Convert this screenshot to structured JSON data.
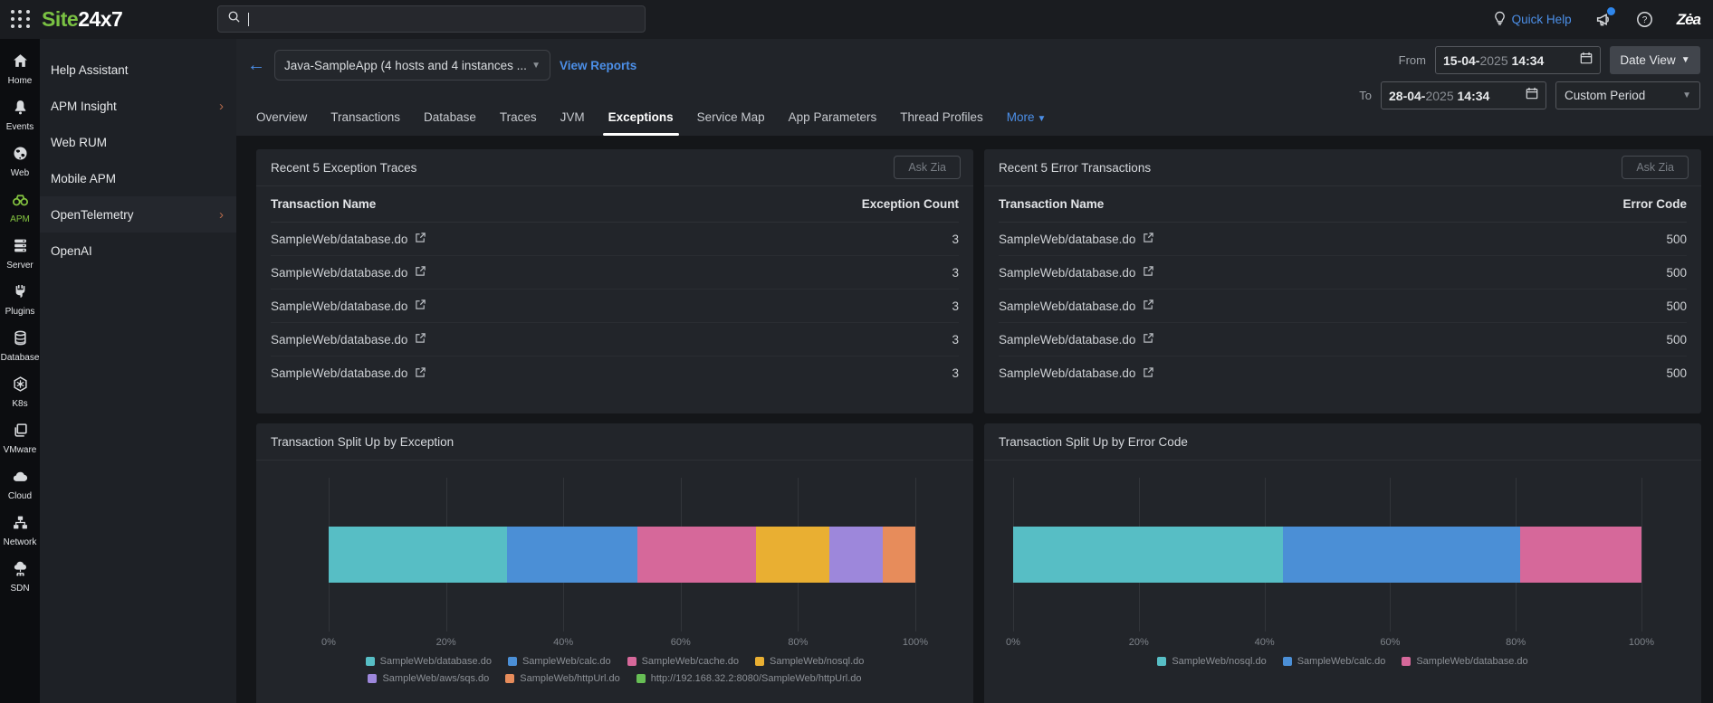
{
  "brand": {
    "name_green": "Site",
    "name_white": "24x7"
  },
  "topbar": {
    "search_value": "",
    "quick_help": "Quick Help"
  },
  "rail": {
    "items": [
      {
        "label": "Home",
        "icon": "home-icon",
        "active": false
      },
      {
        "label": "Events",
        "icon": "bell-icon",
        "active": false
      },
      {
        "label": "Web",
        "icon": "globe-icon",
        "active": false
      },
      {
        "label": "APM",
        "icon": "binoculars-icon",
        "active": true
      },
      {
        "label": "Server",
        "icon": "server-icon",
        "active": false
      },
      {
        "label": "Plugins",
        "icon": "plug-icon",
        "active": false
      },
      {
        "label": "Database",
        "icon": "database-icon",
        "active": false
      },
      {
        "label": "K8s",
        "icon": "k8s-icon",
        "active": false
      },
      {
        "label": "VMware",
        "icon": "vmware-icon",
        "active": false
      },
      {
        "label": "Cloud",
        "icon": "cloud-icon",
        "active": false
      },
      {
        "label": "Network",
        "icon": "network-icon",
        "active": false
      },
      {
        "label": "SDN",
        "icon": "sdn-icon",
        "active": false
      }
    ]
  },
  "sidebar": {
    "items": [
      {
        "label": "Help Assistant",
        "chevron": false,
        "highlight": false
      },
      {
        "label": "APM Insight",
        "chevron": true,
        "highlight": false
      },
      {
        "label": "Web RUM",
        "chevron": false,
        "highlight": false
      },
      {
        "label": "Mobile APM",
        "chevron": false,
        "highlight": false
      },
      {
        "label": "OpenTelemetry",
        "chevron": true,
        "highlight": true
      },
      {
        "label": "OpenAI",
        "chevron": false,
        "highlight": false
      }
    ]
  },
  "toolbar": {
    "app_selector": "Java-SampleApp (4 hosts and 4 instances ...",
    "view_reports": "View Reports"
  },
  "tabs": [
    {
      "label": "Overview",
      "active": false,
      "dropdown": false
    },
    {
      "label": "Transactions",
      "active": false,
      "dropdown": false
    },
    {
      "label": "Database",
      "active": false,
      "dropdown": false
    },
    {
      "label": "Traces",
      "active": false,
      "dropdown": false
    },
    {
      "label": "JVM",
      "active": false,
      "dropdown": false
    },
    {
      "label": "Exceptions",
      "active": true,
      "dropdown": false
    },
    {
      "label": "Service Map",
      "active": false,
      "dropdown": false
    },
    {
      "label": "App Parameters",
      "active": false,
      "dropdown": false
    },
    {
      "label": "Thread Profiles",
      "active": false,
      "dropdown": false
    },
    {
      "label": "More",
      "active": false,
      "dropdown": true
    }
  ],
  "daterange": {
    "from_label": "From",
    "from_day": "15-04-",
    "from_year": "2025",
    "from_time": " 14:34",
    "to_label": "To",
    "to_day": "28-04-",
    "to_year": "2025",
    "to_time": " 14:34",
    "date_view": "Date View",
    "custom_period": "Custom Period"
  },
  "panels": {
    "exception_traces": {
      "title": "Recent 5 Exception Traces",
      "ask_zia": "Ask Zia",
      "columns": [
        "Transaction Name",
        "Exception Count"
      ],
      "rows": [
        {
          "name": "SampleWeb/database.do",
          "value": "3"
        },
        {
          "name": "SampleWeb/database.do",
          "value": "3"
        },
        {
          "name": "SampleWeb/database.do",
          "value": "3"
        },
        {
          "name": "SampleWeb/database.do",
          "value": "3"
        },
        {
          "name": "SampleWeb/database.do",
          "value": "3"
        }
      ]
    },
    "error_transactions": {
      "title": "Recent 5 Error Transactions",
      "ask_zia": "Ask Zia",
      "columns": [
        "Transaction Name",
        "Error Code"
      ],
      "rows": [
        {
          "name": "SampleWeb/database.do",
          "value": "500"
        },
        {
          "name": "SampleWeb/database.do",
          "value": "500"
        },
        {
          "name": "SampleWeb/database.do",
          "value": "500"
        },
        {
          "name": "SampleWeb/database.do",
          "value": "500"
        },
        {
          "name": "SampleWeb/database.do",
          "value": "500"
        }
      ]
    }
  },
  "chart_data": [
    {
      "type": "bar",
      "stacked": true,
      "orientation": "horizontal",
      "title": "Transaction Split Up by Exception",
      "xlim": [
        0,
        100
      ],
      "x_ticks": [
        "0%",
        "20%",
        "40%",
        "60%",
        "80%",
        "100%"
      ],
      "grid": true,
      "legend_position": "bottom",
      "series": [
        {
          "name": "SampleWeb/database.do",
          "value": 30.4,
          "color": "#57BEC5"
        },
        {
          "name": "SampleWeb/calc.do",
          "value": 22.3,
          "color": "#4B8FD6"
        },
        {
          "name": "SampleWeb/cache.do",
          "value": 20.1,
          "color": "#D6689A"
        },
        {
          "name": "SampleWeb/nosql.do",
          "value": 12.6,
          "color": "#E9AF32"
        },
        {
          "name": "SampleWeb/aws/sqs.do",
          "value": 9.1,
          "color": "#9D87DB"
        },
        {
          "name": "SampleWeb/httpUrl.do",
          "value": 5.5,
          "color": "#E78C5B"
        },
        {
          "name": "http://192.168.32.2:8080/SampleWeb/httpUrl.do",
          "value": 0,
          "color": "#67BE55"
        }
      ]
    },
    {
      "type": "bar",
      "stacked": true,
      "orientation": "horizontal",
      "title": "Transaction Split Up by Error Code",
      "xlim": [
        0,
        100
      ],
      "x_ticks": [
        "0%",
        "20%",
        "40%",
        "60%",
        "80%",
        "100%"
      ],
      "grid": true,
      "legend_position": "bottom",
      "series": [
        {
          "name": "SampleWeb/nosql.do",
          "value": 42.9,
          "color": "#57BEC5"
        },
        {
          "name": "SampleWeb/calc.do",
          "value": 37.8,
          "color": "#4B8FD6"
        },
        {
          "name": "SampleWeb/database.do",
          "value": 19.3,
          "color": "#D6689A"
        }
      ]
    }
  ]
}
